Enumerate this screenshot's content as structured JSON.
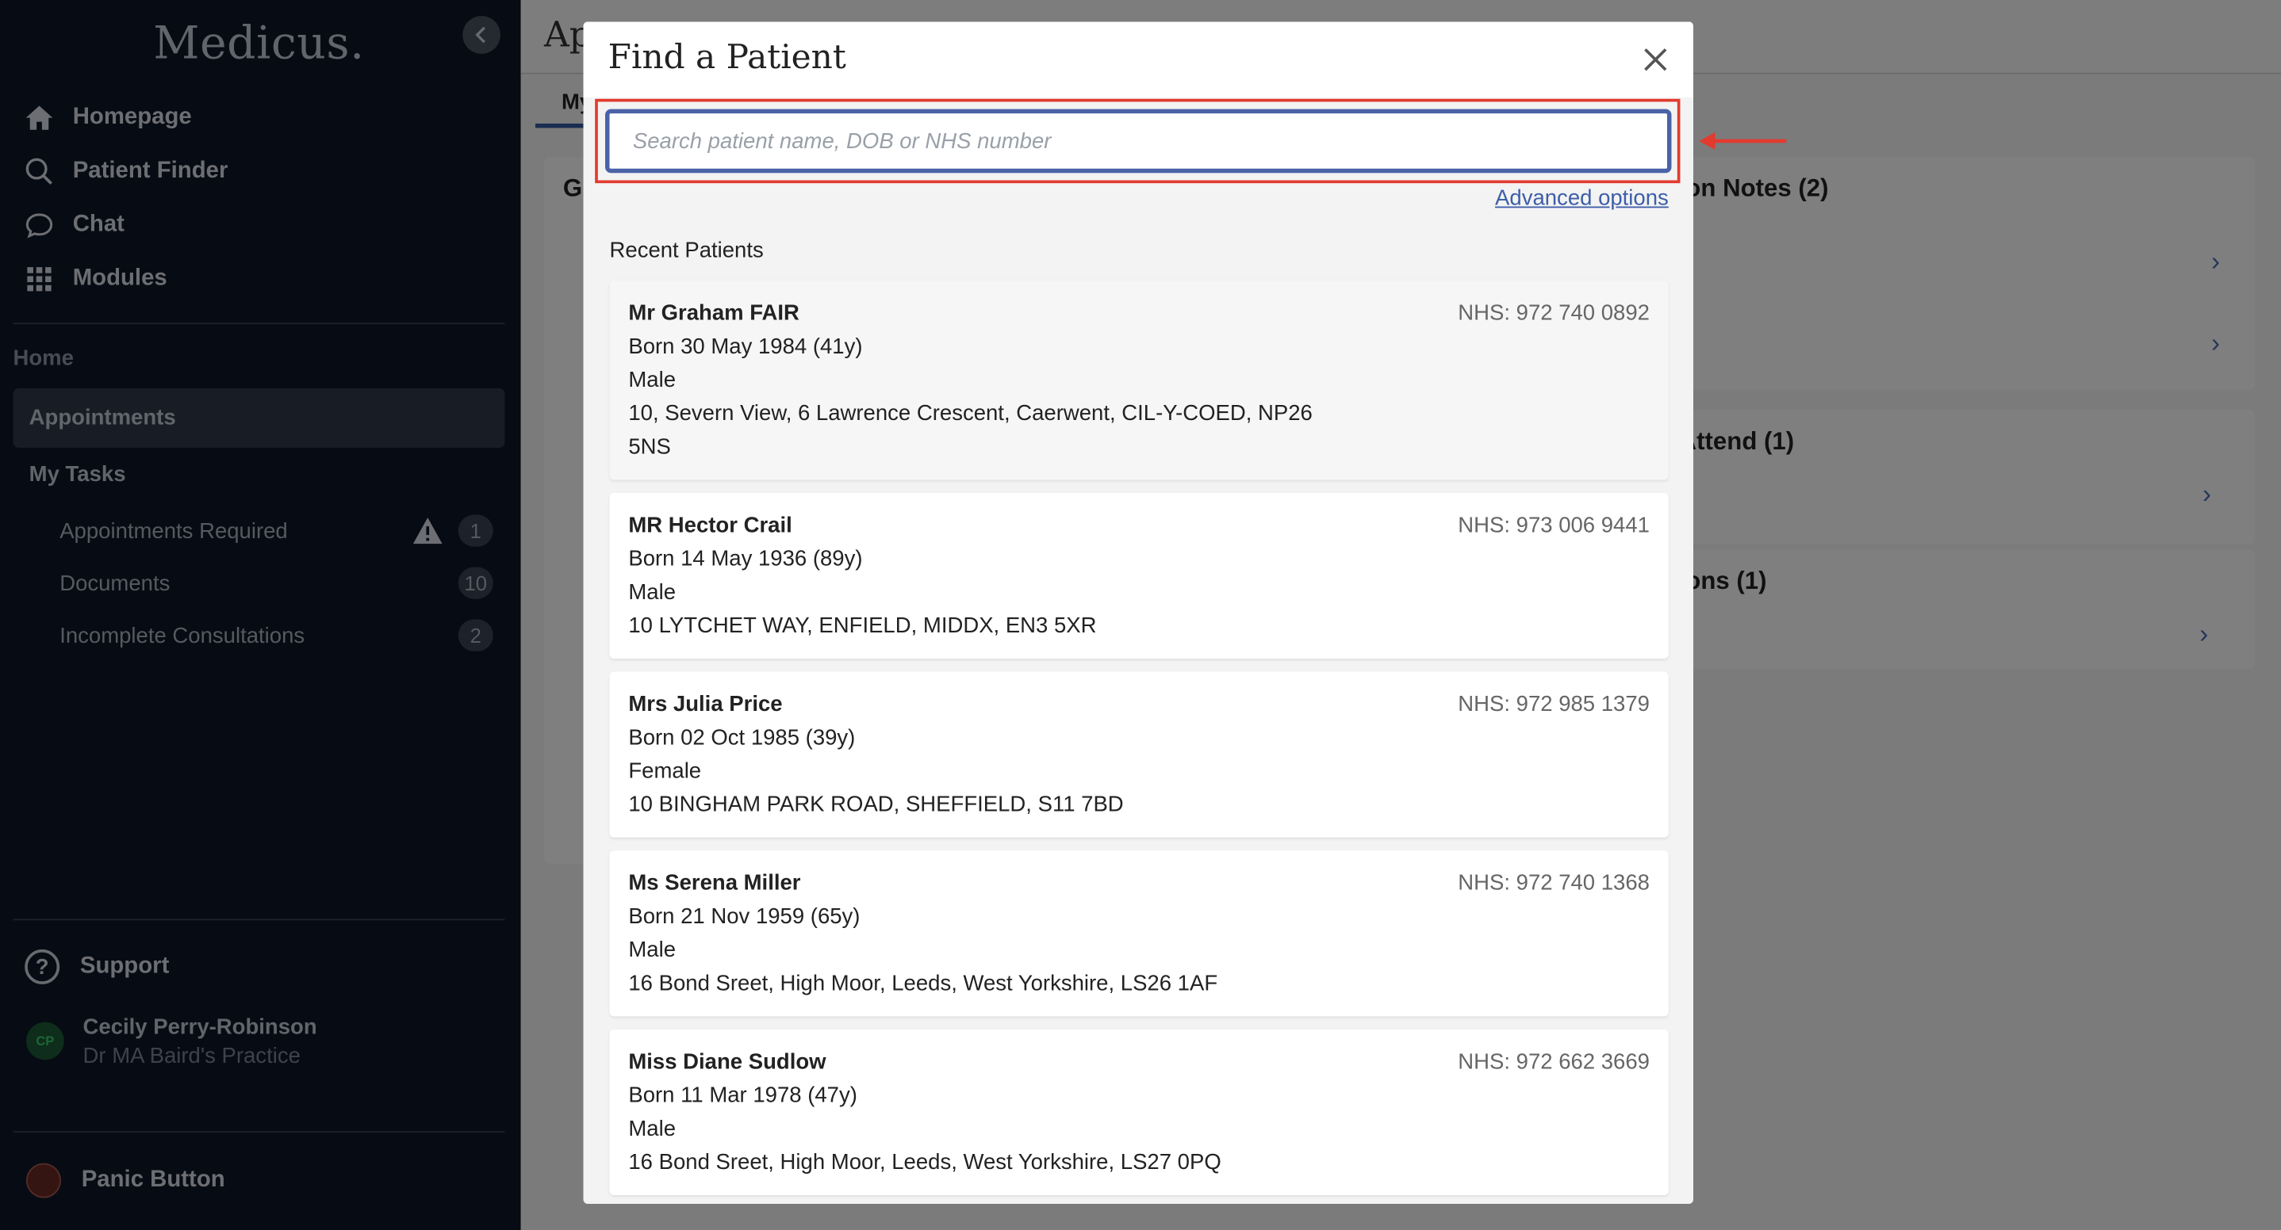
{
  "sidebar": {
    "logo": "Medicus.",
    "nav": [
      "Homepage",
      "Patient Finder",
      "Chat",
      "Modules"
    ],
    "section_home": "Home",
    "active_item": "Appointments",
    "my_tasks": "My Tasks",
    "tasks": [
      {
        "label": "Appointments Required",
        "count": "1"
      },
      {
        "label": "Documents",
        "count": "10"
      },
      {
        "label": "Incomplete Consultations",
        "count": "2"
      }
    ],
    "support": "Support",
    "user": {
      "initials": "CP",
      "name": "Cecily Perry-Robinson",
      "practice": "Dr MA Baird's Practice"
    },
    "panic": "Panic Button"
  },
  "background": {
    "title": "Ap",
    "tab": "My",
    "left_card_letter": "G",
    "cards": [
      "ion Notes (2)",
      "Attend (1)",
      "ions (1)"
    ]
  },
  "modal": {
    "title": "Find a Patient",
    "search_placeholder": "Search patient name, DOB or NHS number",
    "advanced": "Advanced options",
    "recent_label": "Recent Patients",
    "patients": [
      {
        "name": "Mr Graham FAIR",
        "nhs": "NHS: 972 740 0892",
        "born": "Born 30 May 1984 (41y)",
        "sex": "Male",
        "address": "10, Severn View, 6 Lawrence Crescent, Caerwent, CIL-Y-COED, NP26 5NS"
      },
      {
        "name": "MR Hector Crail",
        "nhs": "NHS: 973 006 9441",
        "born": "Born 14 May 1936 (89y)",
        "sex": "Male",
        "address": "10 LYTCHET WAY, ENFIELD, MIDDX, EN3 5XR"
      },
      {
        "name": "Mrs Julia Price",
        "nhs": "NHS: 972 985 1379",
        "born": "Born 02 Oct 1985 (39y)",
        "sex": "Female",
        "address": "10 BINGHAM PARK ROAD, SHEFFIELD, S11 7BD"
      },
      {
        "name": "Ms Serena Miller",
        "nhs": "NHS: 972 740 1368",
        "born": "Born 21 Nov 1959 (65y)",
        "sex": "Male",
        "address": "16 Bond Sreet, High Moor, Leeds, West Yorkshire, LS26 1AF"
      },
      {
        "name": "Miss Diane Sudlow",
        "nhs": "NHS: 972 662 3669",
        "born": "Born 11 Mar 1978 (47y)",
        "sex": "Male",
        "address": "16 Bond Sreet, High Moor, Leeds, West Yorkshire, LS27 0PQ"
      }
    ]
  },
  "colors": {
    "sidebar_bg": "#0e1726",
    "highlight": "#e23b2e",
    "input_border": "#4a62a8",
    "link": "#3d5ea8"
  }
}
